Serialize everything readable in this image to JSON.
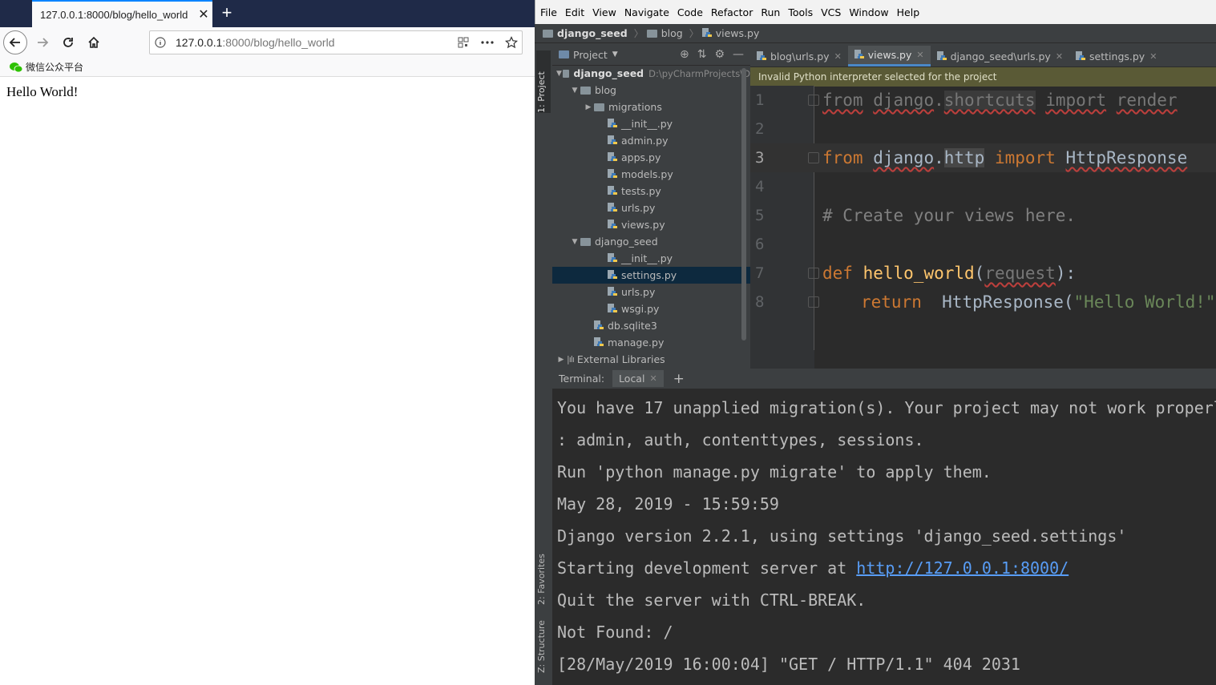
{
  "browser": {
    "tab_title": "127.0.0.1:8000/blog/hello_world",
    "url_host": "127.0.0.1",
    "url_rest": ":8000/blog/hello_world",
    "bookmark": "微信公众平台",
    "page_text": "Hello World!"
  },
  "ide": {
    "menu": [
      "File",
      "Edit",
      "View",
      "Navigate",
      "Code",
      "Refactor",
      "Run",
      "Tools",
      "VCS",
      "Window",
      "Help"
    ],
    "breadcrumb": [
      "django_seed",
      "blog",
      "views.py"
    ],
    "left_tabs": [
      "1: Project",
      "2: Favorites",
      "Z: Structure"
    ],
    "project_header": "Project",
    "tree": [
      {
        "label": "django_seed",
        "extra": "D:\\pyCharmProjects\\D",
        "type": "root"
      },
      {
        "label": "blog",
        "type": "folder"
      },
      {
        "label": "migrations",
        "type": "folder-closed"
      },
      {
        "label": "__init__.py",
        "type": "file"
      },
      {
        "label": "admin.py",
        "type": "file"
      },
      {
        "label": "apps.py",
        "type": "file"
      },
      {
        "label": "models.py",
        "type": "file"
      },
      {
        "label": "tests.py",
        "type": "file"
      },
      {
        "label": "urls.py",
        "type": "file"
      },
      {
        "label": "views.py",
        "type": "file"
      },
      {
        "label": "django_seed",
        "type": "folder"
      },
      {
        "label": "__init__.py",
        "type": "file"
      },
      {
        "label": "settings.py",
        "type": "file"
      },
      {
        "label": "urls.py",
        "type": "file"
      },
      {
        "label": "wsgi.py",
        "type": "file"
      },
      {
        "label": "db.sqlite3",
        "type": "file"
      },
      {
        "label": "manage.py",
        "type": "file"
      },
      {
        "label": "External Libraries",
        "type": "lib"
      }
    ],
    "editor_tabs": [
      "blog\\urls.py",
      "views.py",
      "django_seed\\urls.py",
      "settings.py"
    ],
    "warning": "Invalid Python interpreter selected for the project",
    "code": {
      "l1": {
        "n": "1",
        "kw1": "from",
        "mod1": "django",
        "dot": ".",
        "mod2": "shortcuts",
        "kw2": "import",
        "name": "render"
      },
      "l2": {
        "n": "2"
      },
      "l3": {
        "n": "3",
        "kw1": "from",
        "mod1": "django",
        "dot": ".",
        "mod2": "http",
        "kw2": "import",
        "name": "HttpResponse"
      },
      "l4": {
        "n": "4"
      },
      "l5": {
        "n": "5",
        "comment": "# Create your views here."
      },
      "l6": {
        "n": "6"
      },
      "l7": {
        "n": "7",
        "kw": "def",
        "fn": "hello_world",
        "open": "(",
        "param": "request",
        "close": "):"
      },
      "l8": {
        "n": "8",
        "kw": "return",
        "call": "HttpResponse",
        "open": "(",
        "str": "\"Hello World!\"",
        "close": ")"
      }
    },
    "terminal": {
      "label": "Terminal:",
      "tab": "Local",
      "lines": [
        "You have 17 unapplied migration(s). Your project may not work properl",
        ": admin, auth, contenttypes, sessions.",
        "Run 'python manage.py migrate' to apply them.",
        "May 28, 2019 - 15:59:59",
        "Django version 2.2.1, using settings 'django_seed.settings'",
        "Starting development server at ",
        "Quit the server with CTRL-BREAK.",
        "Not Found: /",
        "[28/May/2019 16:00:04] \"GET / HTTP/1.1\" 404 2031"
      ],
      "link": "http://127.0.0.1:8000/"
    }
  },
  "colors": {
    "tabstrip": "#1f2a48",
    "ide_bg": "#3c3f41",
    "editor_bg": "#2b2b2b",
    "keyword": "#cc7832",
    "function": "#ffc66d",
    "string": "#6a8759",
    "link": "#589df6"
  }
}
